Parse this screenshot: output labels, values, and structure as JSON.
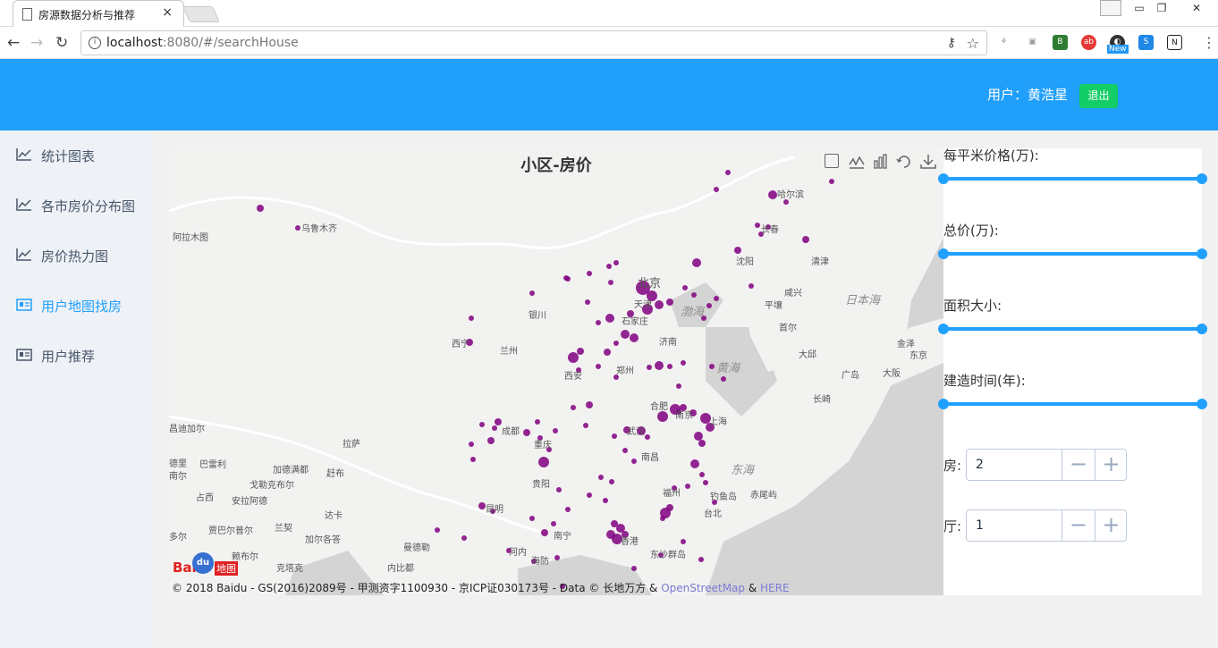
{
  "browser": {
    "tab_title": "房源数据分析与推荐",
    "tab_close": "×",
    "url_host": "localhost",
    "url_rest": ":8080/#/searchHouse",
    "ext_new_badge": "New"
  },
  "header": {
    "user_label": "用户：黄浩星",
    "logout_label": "退出"
  },
  "sidebar": {
    "items": [
      {
        "label": "统计图表",
        "icon": "line-chart-icon",
        "active": false
      },
      {
        "label": "各市房价分布图",
        "icon": "line-chart-icon",
        "active": false
      },
      {
        "label": "房价热力图",
        "icon": "line-chart-icon",
        "active": false
      },
      {
        "label": "用户地图找房",
        "icon": "newspaper-icon",
        "active": true
      },
      {
        "label": "用户推荐",
        "icon": "newspaper-icon",
        "active": false
      }
    ]
  },
  "map": {
    "title": "小区-房价",
    "copyright_prefix": "© 2018 Baidu - GS(2016)2089号 - 甲测资字1100930 - 京ICP证030173号 - Data © 长地万方 & ",
    "copyright_osm": "OpenStreetMap",
    "copyright_amp": " & ",
    "copyright_here": "HERE",
    "logo_bai": "Bai",
    "logo_du": "du",
    "logo_ditu": "地图",
    "point_color": "#800080",
    "cities": [
      {
        "name": "乌鲁木齐"
      },
      {
        "name": "阿拉木图"
      },
      {
        "name": "哈尔滨"
      },
      {
        "name": "长春"
      },
      {
        "name": "沈阳"
      },
      {
        "name": "清津"
      },
      {
        "name": "北京"
      },
      {
        "name": "天津"
      },
      {
        "name": "银川"
      },
      {
        "name": "石家庄"
      },
      {
        "name": "济南"
      },
      {
        "name": "兰州"
      },
      {
        "name": "西宁"
      },
      {
        "name": "西安"
      },
      {
        "name": "郑州"
      },
      {
        "name": "合肥"
      },
      {
        "name": "上海"
      },
      {
        "name": "南京"
      },
      {
        "name": "武汉"
      },
      {
        "name": "成都"
      },
      {
        "name": "重庆"
      },
      {
        "name": "南昌"
      },
      {
        "name": "拉萨"
      },
      {
        "name": "贵阳"
      },
      {
        "name": "昆明"
      },
      {
        "name": "福州"
      },
      {
        "name": "台北"
      },
      {
        "name": "南宁"
      },
      {
        "name": "香港"
      },
      {
        "name": "河内"
      },
      {
        "name": "海防"
      },
      {
        "name": "曼德勒"
      },
      {
        "name": "内比都"
      },
      {
        "name": "达卡"
      },
      {
        "name": "加尔各答"
      },
      {
        "name": "加德满都"
      },
      {
        "name": "赶布"
      },
      {
        "name": "戈勒克布尔"
      },
      {
        "name": "占西"
      },
      {
        "name": "安拉阿德"
      },
      {
        "name": "贾巴尔普尔"
      },
      {
        "name": "兰契"
      },
      {
        "name": "赖布尔"
      },
      {
        "name": "克塔克"
      },
      {
        "name": "巴雷利"
      },
      {
        "name": "昌迪加尔"
      },
      {
        "name": "咸兴"
      },
      {
        "name": "平壤"
      },
      {
        "name": "首尔"
      },
      {
        "name": "大邱"
      },
      {
        "name": "金泽"
      },
      {
        "name": "东京"
      },
      {
        "name": "大阪"
      },
      {
        "name": "广岛"
      },
      {
        "name": "长崎"
      },
      {
        "name": "钓鱼岛"
      },
      {
        "name": "赤尾屿"
      },
      {
        "name": "东沙群岛"
      },
      {
        "name": "多尔"
      },
      {
        "name": "德里"
      },
      {
        "name": "南尔"
      }
    ],
    "seas": [
      {
        "name": "渤海"
      },
      {
        "name": "黄海"
      },
      {
        "name": "东海"
      },
      {
        "name": "日本海"
      }
    ]
  },
  "filters": {
    "sliders": [
      {
        "label": "每平米价格(万):",
        "min_frac": 0,
        "max_frac": 1
      },
      {
        "label": "总价(万):",
        "min_frac": 0,
        "max_frac": 1
      },
      {
        "label": "面积大小:",
        "min_frac": 0,
        "max_frac": 1
      },
      {
        "label": "建造时间(年):",
        "min_frac": 0,
        "max_frac": 1
      }
    ],
    "rooms": {
      "label": "房:",
      "value": "2",
      "minus": "−",
      "plus": "+"
    },
    "halls": {
      "label": "厅:",
      "value": "1",
      "minus": "−",
      "plus": "+"
    }
  }
}
